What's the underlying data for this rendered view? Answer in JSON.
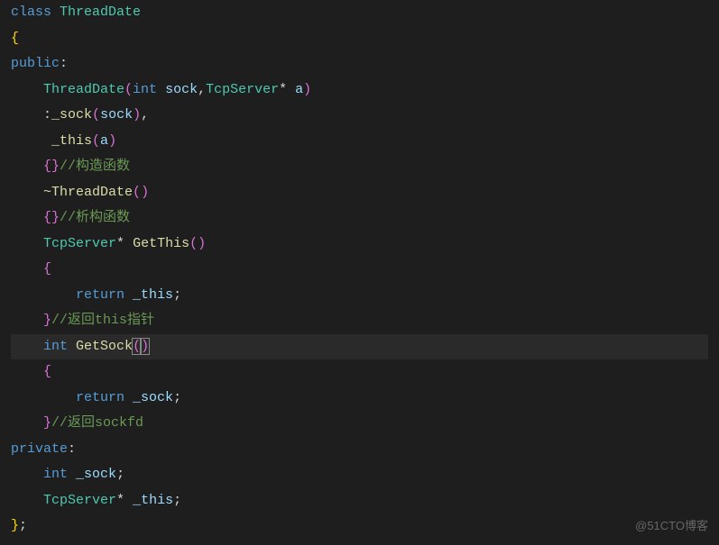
{
  "code": {
    "l1_class": "class",
    "l1_name": "ThreadDate",
    "l2_brace": "{",
    "l3_public": "public",
    "l3_colon": ":",
    "l4_ctor": "ThreadDate",
    "l4_int": "int",
    "l4_sock": "sock",
    "l4_tcpserver": "TcpServer",
    "l4_a": "a",
    "l5_sock_init": "_sock",
    "l5_sock_param": "sock",
    "l6_this_init": "_this",
    "l6_a_param": "a",
    "l7_comment": "//构造函数",
    "l8_dtor": "~ThreadDate",
    "l9_comment": "//析构函数",
    "l10_tcpserver": "TcpServer",
    "l10_getthis": "GetThis",
    "l12_return": "return",
    "l12_this": "_this",
    "l13_comment": "//返回this指针",
    "l14_int": "int",
    "l14_getsock": "GetSock",
    "l16_return": "return",
    "l16_sock": "_sock",
    "l17_comment": "//返回sockfd",
    "l18_private": "private",
    "l18_colon": ":",
    "l19_int": "int",
    "l19_sock": "_sock",
    "l20_tcpserver": "TcpServer",
    "l20_this": "_this"
  },
  "watermark": "@51CTO博客"
}
